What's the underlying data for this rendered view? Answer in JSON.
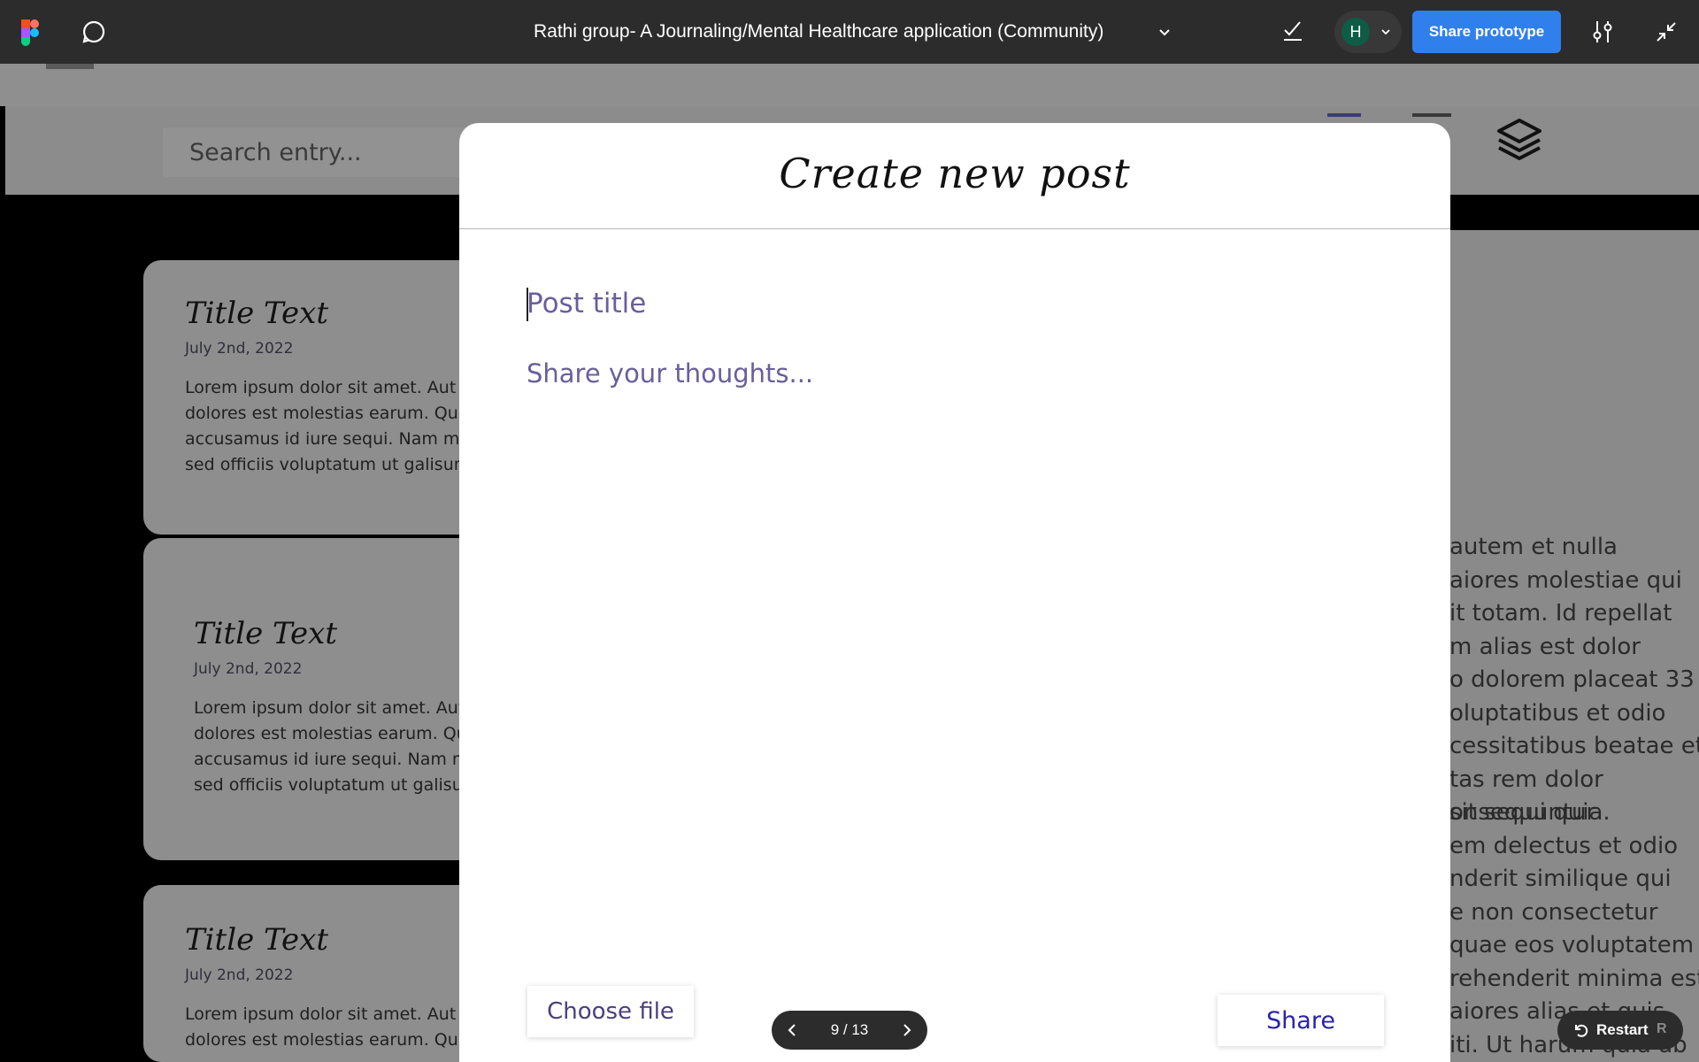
{
  "toolbar": {
    "project_title": "Rathi group- A Journaling/Mental Healthcare application (Community)",
    "avatar_initial": "H",
    "share_label": "Share prototype",
    "icons": [
      "figma-logo-icon",
      "comment-icon",
      "chevron-down-icon",
      "checkmark-icon",
      "settings-sliders-icon",
      "collapse-icon"
    ],
    "accent_color": "#2f80ed",
    "avatar_color": "#0e5c46"
  },
  "background": {
    "search_placeholder": "Search entry...",
    "cards": [
      {
        "title": "Title Text",
        "date": "July 2nd, 2022",
        "lines": [
          "Lorem ipsum dolor sit amet. Aut pari",
          "dolores est molestias earum. Qui qua",
          "accusamus id iure sequi. Nam maiore",
          "sed officiis voluptatum ut galisum cup"
        ]
      },
      {
        "title": "Title Text",
        "date": "July 2nd, 2022",
        "lines": [
          "Lorem ipsum dolor sit amet. Aut par",
          "dolores est molestias earum. Qui qu",
          "accusamus id iure sequi. Nam maio",
          "sed officiis voluptatum ut galisum cu"
        ]
      },
      {
        "title": "Title Text",
        "date": "July 2nd, 2022",
        "lines": [
          "Lorem ipsum dolor sit amet. Aut pari",
          "dolores est molestias earum. Qui qua"
        ]
      }
    ],
    "right_text_block1": [
      "autem et nulla",
      "aiores molestiae qui",
      "it totam. Id repellat",
      "m alias est dolor",
      "o dolorem placeat 33",
      "oluptatibus et odio",
      "cessitatibus beatae et",
      "tas rem dolor",
      "sit sequi quia."
    ],
    "right_text_block2": [
      "onsequuntur",
      "em delectus et odio",
      "nderit similique qui",
      "e non consectetur",
      "quae eos voluptatem",
      "rehenderit minima est",
      "aiores alias et quis",
      "iti. Ut harum quia ab"
    ]
  },
  "modal": {
    "title": "Create new post",
    "post_title_placeholder": "Post title",
    "post_body_placeholder": "Share your thoughts...",
    "choose_file_label": "Choose file",
    "share_label": "Share",
    "text_color": "#4b3f7d",
    "share_color": "#2b23a8"
  },
  "pager": {
    "text": "9 / 13"
  },
  "restart": {
    "label": "Restart",
    "shortcut": "R"
  }
}
